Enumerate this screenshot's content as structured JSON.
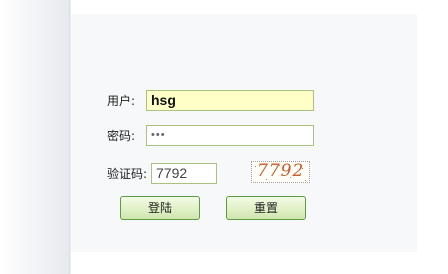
{
  "form": {
    "username_label": "用户:",
    "username_value": "hsg",
    "password_label": "密码:",
    "password_value": "•••",
    "captcha_label": "验证码:",
    "captcha_value": "7792",
    "captcha_image_text": "7792"
  },
  "buttons": {
    "login_label": "登陆",
    "reset_label": "重置"
  }
}
